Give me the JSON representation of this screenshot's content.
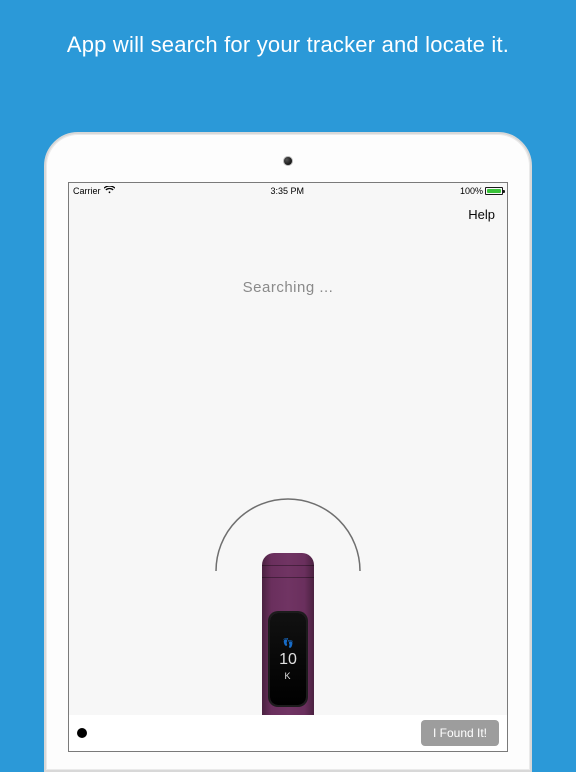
{
  "promo": {
    "headline": "App will search for your tracker and locate it."
  },
  "statusbar": {
    "carrier": "Carrier",
    "time": "3:35 PM",
    "battery_pct": "100%"
  },
  "navbar": {
    "help_label": "Help"
  },
  "main": {
    "searching_label": "Searching ..."
  },
  "tracker_display": {
    "icon_name": "footsteps-icon",
    "value": "10",
    "unit": "K"
  },
  "bottombar": {
    "found_button_label": "I Found It!"
  },
  "colors": {
    "page_bg": "#2b99d8",
    "help_text": "#000000",
    "searching_text": "#8a8a8a",
    "found_btn_bg": "#9d9d9d",
    "band": "#6a2f5d"
  }
}
